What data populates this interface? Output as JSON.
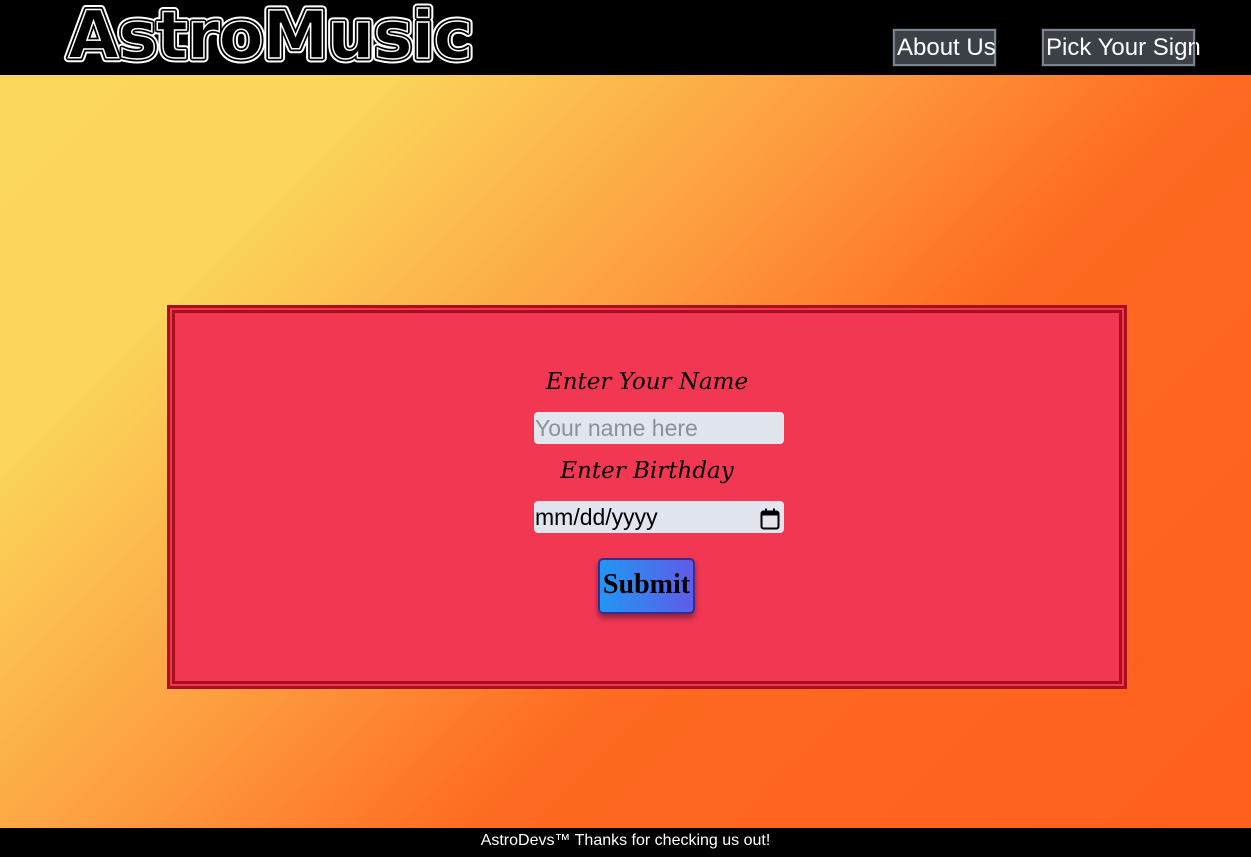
{
  "header": {
    "logo_text": "AstroMusic",
    "nav": {
      "about_label": "About Us",
      "sign_label": "Pick Your Sign"
    }
  },
  "form": {
    "name_label": "Enter Your Name",
    "name_placeholder": "Your name here",
    "birthday_label": "Enter Birthday",
    "birthday_value": "mm/dd/yyyy",
    "submit_label": "Submit",
    "icons": {
      "calendar": "calendar-icon"
    }
  },
  "footer": {
    "text": "AstroDevs™ Thanks for checking us out!"
  },
  "colors": {
    "header_bg": "#000000",
    "panel_bg": "#f23753",
    "panel_border": "#a8101d",
    "input_bg": "#e1e5ee",
    "button_gradient_start": "#2196f3",
    "button_gradient_end": "#5f5ce8",
    "page_gradient_start": "#fbd85c",
    "page_gradient_end": "#ff5f1c"
  }
}
